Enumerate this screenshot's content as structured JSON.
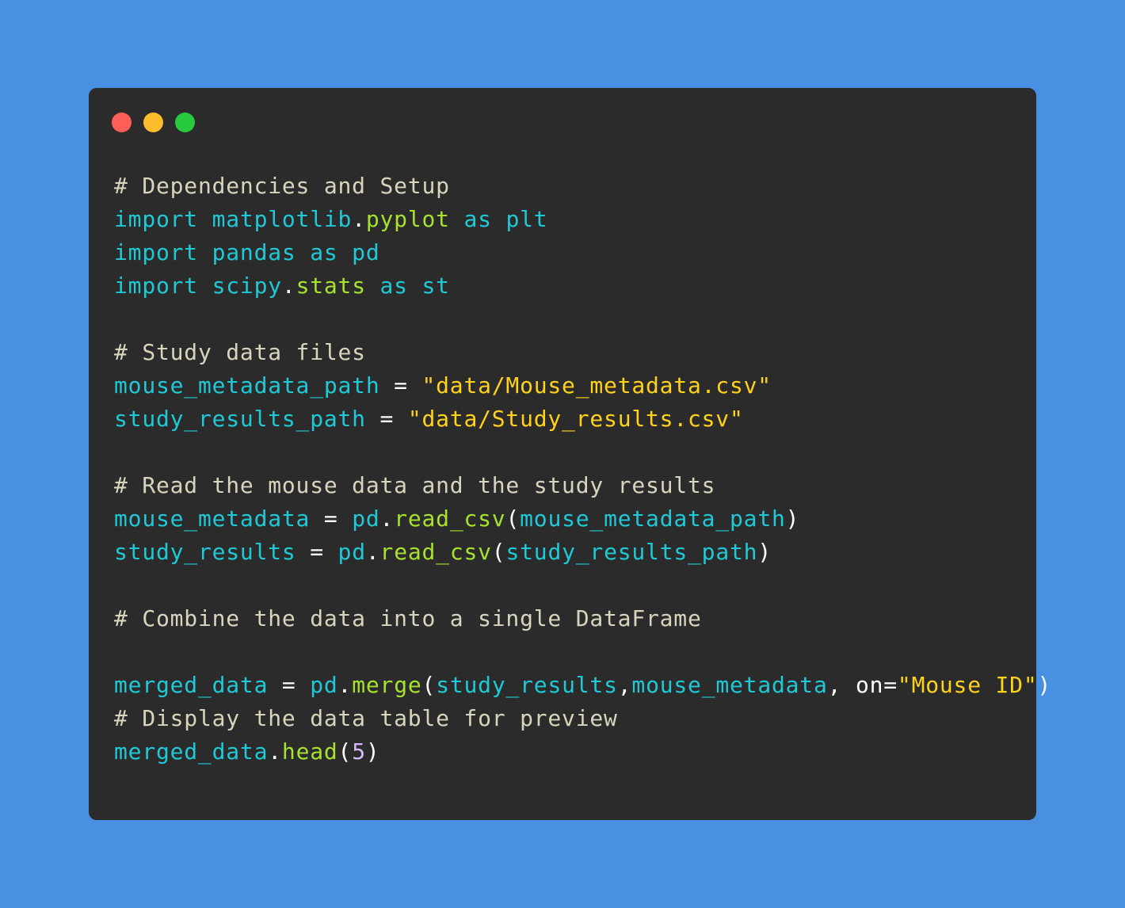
{
  "colors": {
    "background": "#4a90e2",
    "window": "#2b2b2b",
    "close_dot": "#ff5f56",
    "minimize_dot": "#ffbd2e",
    "maximize_dot": "#27c93f",
    "comment": "#d8d4bd",
    "identifier": "#1fc9d6",
    "attribute": "#a6e22e",
    "string": "#ffd21c",
    "punctuation": "#ffffff",
    "number": "#d9b8ff"
  },
  "window_controls": {
    "close": "close-dot",
    "minimize": "minimize-dot",
    "maximize": "maximize-dot"
  },
  "code": [
    {
      "tokens": [
        {
          "t": "# Dependencies and Setup",
          "k": "comment"
        }
      ]
    },
    {
      "tokens": [
        {
          "t": "import matplotlib",
          "k": "identifier"
        },
        {
          "t": ".",
          "k": "punctuation"
        },
        {
          "t": "pyplot",
          "k": "attribute"
        },
        {
          "t": " as plt",
          "k": "identifier"
        }
      ]
    },
    {
      "tokens": [
        {
          "t": "import pandas as pd",
          "k": "identifier"
        }
      ]
    },
    {
      "tokens": [
        {
          "t": "import scipy",
          "k": "identifier"
        },
        {
          "t": ".",
          "k": "punctuation"
        },
        {
          "t": "stats",
          "k": "attribute"
        },
        {
          "t": " as st",
          "k": "identifier"
        }
      ]
    },
    {
      "tokens": []
    },
    {
      "tokens": [
        {
          "t": "# Study data files",
          "k": "comment"
        }
      ]
    },
    {
      "tokens": [
        {
          "t": "mouse_metadata_path",
          "k": "identifier"
        },
        {
          "t": " = ",
          "k": "punctuation"
        },
        {
          "t": "\"data/Mouse_metadata.csv\"",
          "k": "string"
        }
      ]
    },
    {
      "tokens": [
        {
          "t": "study_results_path",
          "k": "identifier"
        },
        {
          "t": " = ",
          "k": "punctuation"
        },
        {
          "t": "\"data/Study_results.csv\"",
          "k": "string"
        }
      ]
    },
    {
      "tokens": []
    },
    {
      "tokens": [
        {
          "t": "# Read the mouse data and the study results",
          "k": "comment"
        }
      ]
    },
    {
      "tokens": [
        {
          "t": "mouse_metadata",
          "k": "identifier"
        },
        {
          "t": " = ",
          "k": "punctuation"
        },
        {
          "t": "pd",
          "k": "identifier"
        },
        {
          "t": ".",
          "k": "punctuation"
        },
        {
          "t": "read_csv",
          "k": "attribute"
        },
        {
          "t": "(",
          "k": "punctuation"
        },
        {
          "t": "mouse_metadata_path",
          "k": "identifier"
        },
        {
          "t": ")",
          "k": "punctuation"
        }
      ]
    },
    {
      "tokens": [
        {
          "t": "study_results",
          "k": "identifier"
        },
        {
          "t": " = ",
          "k": "punctuation"
        },
        {
          "t": "pd",
          "k": "identifier"
        },
        {
          "t": ".",
          "k": "punctuation"
        },
        {
          "t": "read_csv",
          "k": "attribute"
        },
        {
          "t": "(",
          "k": "punctuation"
        },
        {
          "t": "study_results_path",
          "k": "identifier"
        },
        {
          "t": ")",
          "k": "punctuation"
        }
      ]
    },
    {
      "tokens": []
    },
    {
      "tokens": [
        {
          "t": "# Combine the data into a single DataFrame",
          "k": "comment"
        }
      ]
    },
    {
      "tokens": []
    },
    {
      "tokens": [
        {
          "t": "merged_data",
          "k": "identifier"
        },
        {
          "t": " = ",
          "k": "punctuation"
        },
        {
          "t": "pd",
          "k": "identifier"
        },
        {
          "t": ".",
          "k": "punctuation"
        },
        {
          "t": "merge",
          "k": "attribute"
        },
        {
          "t": "(",
          "k": "punctuation"
        },
        {
          "t": "study_results",
          "k": "identifier"
        },
        {
          "t": ",",
          "k": "punctuation"
        },
        {
          "t": "mouse_metadata",
          "k": "identifier"
        },
        {
          "t": ", on=",
          "k": "punctuation"
        },
        {
          "t": "\"Mouse ID\"",
          "k": "string"
        },
        {
          "t": ")",
          "k": "punctuation"
        }
      ]
    },
    {
      "tokens": [
        {
          "t": "# Display the data table for preview",
          "k": "comment"
        }
      ]
    },
    {
      "tokens": [
        {
          "t": "merged_data",
          "k": "identifier"
        },
        {
          "t": ".",
          "k": "punctuation"
        },
        {
          "t": "head",
          "k": "attribute"
        },
        {
          "t": "(",
          "k": "punctuation"
        },
        {
          "t": "5",
          "k": "number"
        },
        {
          "t": ")",
          "k": "punctuation"
        }
      ]
    }
  ]
}
